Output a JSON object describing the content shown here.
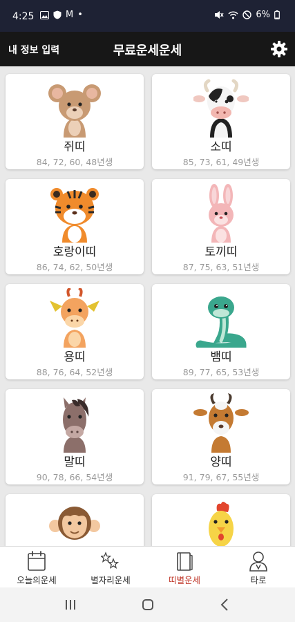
{
  "status": {
    "time": "4:25",
    "mail": "M",
    "dot": "•",
    "battery": "6%"
  },
  "header": {
    "my_info": "내 정보 입력",
    "title": "무료운세운세"
  },
  "animals": [
    {
      "name": "쥐띠",
      "years": "84, 72, 60, 48년생"
    },
    {
      "name": "소띠",
      "years": "85, 73, 61, 49년생"
    },
    {
      "name": "호랑이띠",
      "years": "86, 74, 62, 50년생"
    },
    {
      "name": "토끼띠",
      "years": "87, 75, 63, 51년생"
    },
    {
      "name": "용띠",
      "years": "88, 76, 64, 52년생"
    },
    {
      "name": "뱀띠",
      "years": "89, 77, 65, 53년생"
    },
    {
      "name": "말띠",
      "years": "90, 78, 66, 54년생"
    },
    {
      "name": "양띠",
      "years": "91, 79, 67, 55년생"
    }
  ],
  "nav": [
    {
      "label": "오늘의운세",
      "icon": "calendar-icon"
    },
    {
      "label": "별자리운세",
      "icon": "stars-icon"
    },
    {
      "label": "띠별운세",
      "icon": "book-icon"
    },
    {
      "label": "타로",
      "icon": "person-icon"
    }
  ],
  "colors": {
    "header": "#171717",
    "status": "#1e2234",
    "active": "#c0392b"
  }
}
